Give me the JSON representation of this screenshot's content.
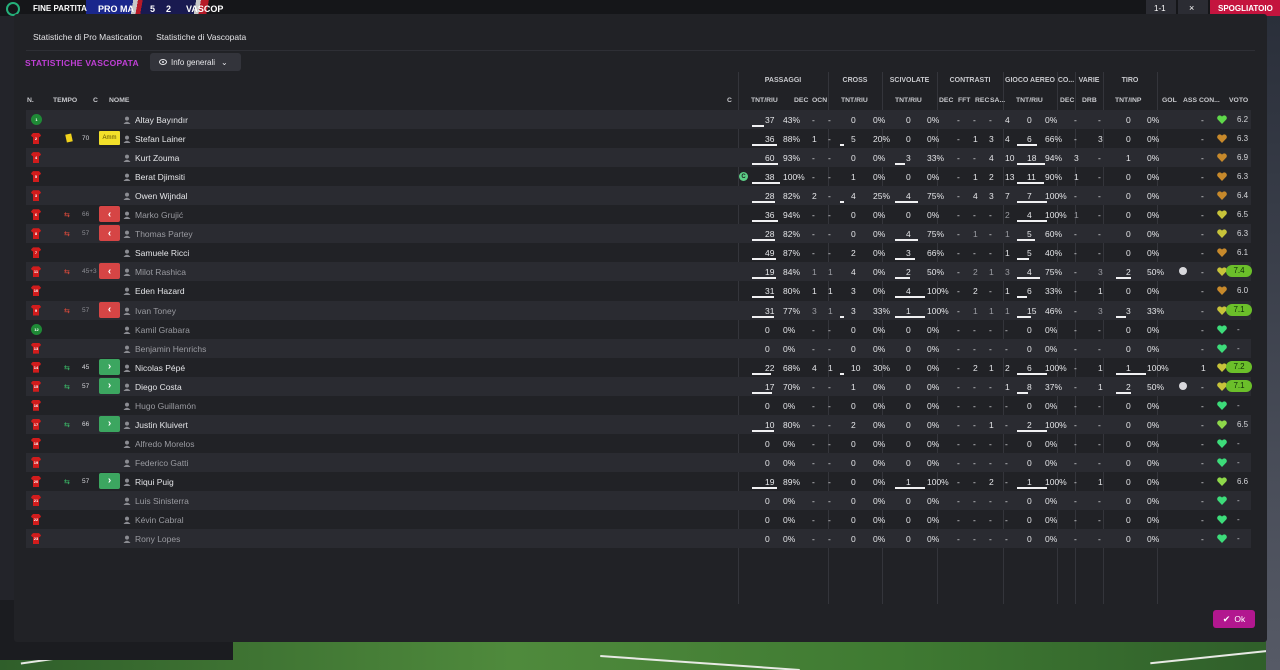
{
  "topbar": {
    "status": "FINE PARTITA",
    "home_short": "PRO MA",
    "score_home": "5",
    "score_away": "2",
    "away_short": "VASCOP",
    "score_display": "1-1",
    "right_button": "SPOGLIATOIO"
  },
  "tabs": [
    "Statistiche di Pro Mastication",
    "Statistiche di Vascopata"
  ],
  "section_title": "STATISTICHE VASCOPATA",
  "dropdown_label": "Info generali",
  "groups": {
    "passaggi": "PASSAGGI",
    "cross": "CROSS",
    "scivolate": "SCIVOLATE",
    "contrasti": "CONTRASTI",
    "gioco_aereo": "GIOCO AEREO",
    "co": "CO...",
    "varie": "VARIE",
    "tiro": "TIRO"
  },
  "columns": {
    "n": "N.",
    "tempo": "TEMPO",
    "c": "C",
    "nome": "NOME",
    "c2": "C",
    "pass_tnt": "TNT/RIU",
    "pass_dec": "DEC",
    "pass_ocn": "OCN",
    "cross_tnt": "TNT/RIU",
    "sciv_tnt": "TNT/RIU",
    "con_dec": "DEC",
    "con_fft": "FFT",
    "con_rec": "REC",
    "con_sa": "SA...",
    "aer_tnt": "TNT/RIU",
    "co_dec": "DEC",
    "var_drb": "DRB",
    "tiro_tnt": "TNT/INP",
    "gol": "GOL",
    "ass": "ASS",
    "con": "CON...",
    "voto": "VOTO"
  },
  "players": [
    {
      "num": "1",
      "name": "Altay Bayındır",
      "active": true,
      "gk": true,
      "card": "",
      "min": "",
      "sub": "",
      "pt": "37",
      "pp": "43%",
      "pd": "-",
      "po": "-",
      "ct": "0",
      "cp": "0%",
      "st": "0",
      "sp": "0%",
      "dec": "-",
      "fft": "-",
      "rec": "-",
      "sa": "4",
      "at": "0",
      "ap": "0%",
      "cd": "-",
      "drb": "-",
      "tt": "0",
      "tp": "0%",
      "gol": "",
      "ass": "-",
      "vote": "6.2",
      "hi": false,
      "heart": "#5fd84a"
    },
    {
      "num": "2",
      "name": "Stefan Lainer",
      "active": true,
      "card": "yellow",
      "amm": "Amm",
      "min": "70",
      "sub": "",
      "pt": "36",
      "pp": "88%",
      "pd": "1",
      "po": "-",
      "ct": "5",
      "cp": "20%",
      "st": "0",
      "sp": "0%",
      "dec": "-",
      "fft": "1",
      "rec": "3",
      "sa": "4",
      "at": "6",
      "ap": "66%",
      "cd": "-",
      "drb": "3",
      "tt": "0",
      "tp": "0%",
      "gol": "",
      "ass": "-",
      "vote": "6.3",
      "hi": false,
      "heart": "#c7892b"
    },
    {
      "num": "4",
      "name": "Kurt Zouma",
      "active": true,
      "card": "",
      "min": "",
      "sub": "",
      "pt": "60",
      "pp": "93%",
      "pd": "-",
      "po": "-",
      "ct": "0",
      "cp": "0%",
      "st": "3",
      "sp": "33%",
      "dec": "-",
      "fft": "-",
      "rec": "4",
      "sa": "10",
      "at": "18",
      "ap": "94%",
      "cd": "3",
      "drb": "-",
      "tt": "1",
      "tp": "0%",
      "gol": "",
      "ass": "-",
      "vote": "6.9",
      "hi": false,
      "heart": "#c7892b"
    },
    {
      "num": "5",
      "name": "Berat Djimsiti",
      "active": true,
      "card": "",
      "min": "",
      "sub": "",
      "assist_badge": "C",
      "pt": "38",
      "pp": "100%",
      "pd": "-",
      "po": "-",
      "ct": "1",
      "cp": "0%",
      "st": "0",
      "sp": "0%",
      "dec": "-",
      "fft": "1",
      "rec": "2",
      "sa": "13",
      "at": "11",
      "ap": "90%",
      "cd": "1",
      "drb": "-",
      "tt": "0",
      "tp": "0%",
      "gol": "",
      "ass": "-",
      "vote": "6.3",
      "hi": false,
      "heart": "#c7892b"
    },
    {
      "num": "3",
      "name": "Owen Wijndal",
      "active": true,
      "card": "",
      "min": "",
      "sub": "",
      "pt": "28",
      "pp": "82%",
      "pd": "2",
      "po": "-",
      "ct": "4",
      "cp": "25%",
      "st": "4",
      "sp": "75%",
      "dec": "-",
      "fft": "4",
      "rec": "3",
      "sa": "7",
      "at": "7",
      "ap": "100%",
      "cd": "-",
      "drb": "-",
      "tt": "0",
      "tp": "0%",
      "gol": "",
      "ass": "-",
      "vote": "6.4",
      "hi": false,
      "heart": "#c7892b"
    },
    {
      "num": "6",
      "name": "Marko Grujić",
      "active": false,
      "card": "",
      "min": "66",
      "sub": "out",
      "pt": "36",
      "pp": "94%",
      "pd": "-",
      "po": "-",
      "ct": "0",
      "cp": "0%",
      "st": "0",
      "sp": "0%",
      "dec": "-",
      "fft": "-",
      "rec": "-",
      "sa": "2",
      "at": "4",
      "ap": "100%",
      "cd": "1",
      "drb": "-",
      "tt": "0",
      "tp": "0%",
      "gol": "",
      "ass": "-",
      "vote": "6.5",
      "hi": false,
      "heart": "#c7c33a"
    },
    {
      "num": "8",
      "name": "Thomas Partey",
      "active": false,
      "card": "",
      "min": "57",
      "sub": "out",
      "pt": "28",
      "pp": "82%",
      "pd": "-",
      "po": "-",
      "ct": "0",
      "cp": "0%",
      "st": "4",
      "sp": "75%",
      "dec": "-",
      "fft": "1",
      "rec": "-",
      "sa": "1",
      "at": "5",
      "ap": "60%",
      "cd": "-",
      "drb": "-",
      "tt": "0",
      "tp": "0%",
      "gol": "",
      "ass": "-",
      "vote": "6.3",
      "hi": false,
      "heart": "#c7c33a"
    },
    {
      "num": "7",
      "name": "Samuele Ricci",
      "active": true,
      "card": "",
      "min": "",
      "sub": "",
      "pt": "49",
      "pp": "87%",
      "pd": "-",
      "po": "-",
      "ct": "2",
      "cp": "0%",
      "st": "3",
      "sp": "66%",
      "dec": "-",
      "fft": "-",
      "rec": "-",
      "sa": "1",
      "at": "5",
      "ap": "40%",
      "cd": "-",
      "drb": "-",
      "tt": "0",
      "tp": "0%",
      "gol": "",
      "ass": "-",
      "vote": "6.1",
      "hi": false,
      "heart": "#c7892b"
    },
    {
      "num": "11",
      "name": "Milot Rashica",
      "active": false,
      "card": "",
      "min": "45+3",
      "sub": "out",
      "pt": "19",
      "pp": "84%",
      "pd": "1",
      "po": "1",
      "ct": "4",
      "cp": "0%",
      "st": "2",
      "sp": "50%",
      "dec": "-",
      "fft": "2",
      "rec": "1",
      "sa": "3",
      "at": "4",
      "ap": "75%",
      "cd": "-",
      "drb": "3",
      "tt": "2",
      "tp": "50%",
      "gol": "ball",
      "ass": "-",
      "vote": "7.4",
      "hi": true,
      "heart": "#c7c33a"
    },
    {
      "num": "10",
      "name": "Eden Hazard",
      "active": true,
      "card": "",
      "min": "",
      "sub": "",
      "pt": "31",
      "pp": "80%",
      "pd": "1",
      "po": "1",
      "ct": "3",
      "cp": "0%",
      "st": "4",
      "sp": "100%",
      "dec": "-",
      "fft": "2",
      "rec": "-",
      "sa": "1",
      "at": "6",
      "ap": "33%",
      "cd": "-",
      "drb": "1",
      "tt": "0",
      "tp": "0%",
      "gol": "",
      "ass": "-",
      "vote": "6.0",
      "hi": false,
      "heart": "#c7892b"
    },
    {
      "num": "9",
      "name": "Ivan Toney",
      "active": false,
      "card": "",
      "min": "57",
      "sub": "out",
      "pt": "31",
      "pp": "77%",
      "pd": "3",
      "po": "1",
      "ct": "3",
      "cp": "33%",
      "st": "1",
      "sp": "100%",
      "dec": "-",
      "fft": "1",
      "rec": "1",
      "sa": "1",
      "at": "15",
      "ap": "46%",
      "cd": "-",
      "drb": "3",
      "tt": "3",
      "tp": "33%",
      "gol": "",
      "ass": "-",
      "vote": "7.1",
      "hi": true,
      "heart": "#c7c33a"
    },
    {
      "num": "12",
      "name": "Kamil Grabara",
      "active": false,
      "gk": true,
      "card": "",
      "min": "",
      "sub": "",
      "pt": "0",
      "pp": "0%",
      "pd": "-",
      "po": "-",
      "ct": "0",
      "cp": "0%",
      "st": "0",
      "sp": "0%",
      "dec": "-",
      "fft": "-",
      "rec": "-",
      "sa": "-",
      "at": "0",
      "ap": "0%",
      "cd": "-",
      "drb": "-",
      "tt": "0",
      "tp": "0%",
      "gol": "",
      "ass": "-",
      "vote": "-",
      "hi": false,
      "heart": "#3ddc7a"
    },
    {
      "num": "13",
      "name": "Benjamin Henrichs",
      "active": false,
      "card": "",
      "min": "",
      "sub": "",
      "pt": "0",
      "pp": "0%",
      "pd": "-",
      "po": "-",
      "ct": "0",
      "cp": "0%",
      "st": "0",
      "sp": "0%",
      "dec": "-",
      "fft": "-",
      "rec": "-",
      "sa": "-",
      "at": "0",
      "ap": "0%",
      "cd": "-",
      "drb": "-",
      "tt": "0",
      "tp": "0%",
      "gol": "",
      "ass": "-",
      "vote": "-",
      "hi": false,
      "heart": "#3ddc7a"
    },
    {
      "num": "14",
      "name": "Nicolas Pépé",
      "active": true,
      "card": "",
      "min": "45",
      "sub": "in",
      "pt": "22",
      "pp": "68%",
      "pd": "4",
      "po": "1",
      "ct": "10",
      "cp": "30%",
      "st": "0",
      "sp": "0%",
      "dec": "-",
      "fft": "2",
      "rec": "1",
      "sa": "2",
      "at": "6",
      "ap": "100%",
      "cd": "-",
      "drb": "1",
      "tt": "1",
      "tp": "100%",
      "gol": "",
      "ass": "1",
      "vote": "7.2",
      "hi": true,
      "heart": "#c7c33a"
    },
    {
      "num": "15",
      "name": "Diego Costa",
      "active": true,
      "card": "",
      "min": "57",
      "sub": "in",
      "pt": "17",
      "pp": "70%",
      "pd": "-",
      "po": "-",
      "ct": "1",
      "cp": "0%",
      "st": "0",
      "sp": "0%",
      "dec": "-",
      "fft": "-",
      "rec": "-",
      "sa": "1",
      "at": "8",
      "ap": "37%",
      "cd": "-",
      "drb": "1",
      "tt": "2",
      "tp": "50%",
      "gol": "ball",
      "ass": "-",
      "vote": "7.1",
      "hi": true,
      "heart": "#c7c33a"
    },
    {
      "num": "16",
      "name": "Hugo Guillamón",
      "active": false,
      "card": "",
      "min": "",
      "sub": "",
      "pt": "0",
      "pp": "0%",
      "pd": "-",
      "po": "-",
      "ct": "0",
      "cp": "0%",
      "st": "0",
      "sp": "0%",
      "dec": "-",
      "fft": "-",
      "rec": "-",
      "sa": "-",
      "at": "0",
      "ap": "0%",
      "cd": "-",
      "drb": "-",
      "tt": "0",
      "tp": "0%",
      "gol": "",
      "ass": "-",
      "vote": "-",
      "hi": false,
      "heart": "#3ddc7a"
    },
    {
      "num": "17",
      "name": "Justin Kluivert",
      "active": true,
      "card": "",
      "min": "66",
      "sub": "in",
      "pt": "10",
      "pp": "80%",
      "pd": "-",
      "po": "-",
      "ct": "2",
      "cp": "0%",
      "st": "0",
      "sp": "0%",
      "dec": "-",
      "fft": "-",
      "rec": "1",
      "sa": "-",
      "at": "2",
      "ap": "100%",
      "cd": "-",
      "drb": "-",
      "tt": "0",
      "tp": "0%",
      "gol": "",
      "ass": "-",
      "vote": "6.5",
      "hi": false,
      "heart": "#8ed84a"
    },
    {
      "num": "18",
      "name": "Alfredo Morelos",
      "active": false,
      "card": "",
      "min": "",
      "sub": "",
      "pt": "0",
      "pp": "0%",
      "pd": "-",
      "po": "-",
      "ct": "0",
      "cp": "0%",
      "st": "0",
      "sp": "0%",
      "dec": "-",
      "fft": "-",
      "rec": "-",
      "sa": "-",
      "at": "0",
      "ap": "0%",
      "cd": "-",
      "drb": "-",
      "tt": "0",
      "tp": "0%",
      "gol": "",
      "ass": "-",
      "vote": "-",
      "hi": false,
      "heart": "#3ddc7a"
    },
    {
      "num": "19",
      "name": "Federico Gatti",
      "active": false,
      "card": "",
      "min": "",
      "sub": "",
      "pt": "0",
      "pp": "0%",
      "pd": "-",
      "po": "-",
      "ct": "0",
      "cp": "0%",
      "st": "0",
      "sp": "0%",
      "dec": "-",
      "fft": "-",
      "rec": "-",
      "sa": "-",
      "at": "0",
      "ap": "0%",
      "cd": "-",
      "drb": "-",
      "tt": "0",
      "tp": "0%",
      "gol": "",
      "ass": "-",
      "vote": "-",
      "hi": false,
      "heart": "#3ddc7a"
    },
    {
      "num": "20",
      "name": "Riqui Puig",
      "active": true,
      "card": "",
      "min": "57",
      "sub": "in",
      "pt": "19",
      "pp": "89%",
      "pd": "-",
      "po": "-",
      "ct": "0",
      "cp": "0%",
      "st": "1",
      "sp": "100%",
      "dec": "-",
      "fft": "-",
      "rec": "2",
      "sa": "-",
      "at": "1",
      "ap": "100%",
      "cd": "-",
      "drb": "1",
      "tt": "0",
      "tp": "0%",
      "gol": "",
      "ass": "-",
      "vote": "6.6",
      "hi": false,
      "heart": "#8ed84a"
    },
    {
      "num": "21",
      "name": "Luis Sinisterra",
      "active": false,
      "card": "",
      "min": "",
      "sub": "",
      "pt": "0",
      "pp": "0%",
      "pd": "-",
      "po": "-",
      "ct": "0",
      "cp": "0%",
      "st": "0",
      "sp": "0%",
      "dec": "-",
      "fft": "-",
      "rec": "-",
      "sa": "-",
      "at": "0",
      "ap": "0%",
      "cd": "-",
      "drb": "-",
      "tt": "0",
      "tp": "0%",
      "gol": "",
      "ass": "-",
      "vote": "-",
      "hi": false,
      "heart": "#3ddc7a"
    },
    {
      "num": "22",
      "name": "Kévin Cabral",
      "active": false,
      "card": "",
      "min": "",
      "sub": "",
      "pt": "0",
      "pp": "0%",
      "pd": "-",
      "po": "-",
      "ct": "0",
      "cp": "0%",
      "st": "0",
      "sp": "0%",
      "dec": "-",
      "fft": "-",
      "rec": "-",
      "sa": "-",
      "at": "0",
      "ap": "0%",
      "cd": "-",
      "drb": "-",
      "tt": "0",
      "tp": "0%",
      "gol": "",
      "ass": "-",
      "vote": "-",
      "hi": false,
      "heart": "#3ddc7a"
    },
    {
      "num": "23",
      "name": "Rony Lopes",
      "active": false,
      "card": "",
      "min": "",
      "sub": "",
      "pt": "0",
      "pp": "0%",
      "pd": "-",
      "po": "-",
      "ct": "0",
      "cp": "0%",
      "st": "0",
      "sp": "0%",
      "dec": "-",
      "fft": "-",
      "rec": "-",
      "sa": "-",
      "at": "0",
      "ap": "0%",
      "cd": "-",
      "drb": "-",
      "tt": "0",
      "tp": "0%",
      "gol": "",
      "ass": "-",
      "vote": "-",
      "hi": false,
      "heart": "#3ddc7a"
    }
  ],
  "ok_label": "Ok",
  "colors": {
    "accent": "#c03fd6",
    "ok_button": "#b2178f",
    "sub_out": "#d64545",
    "sub_in": "#3ca660",
    "rating_high": "#6bbf2a"
  }
}
